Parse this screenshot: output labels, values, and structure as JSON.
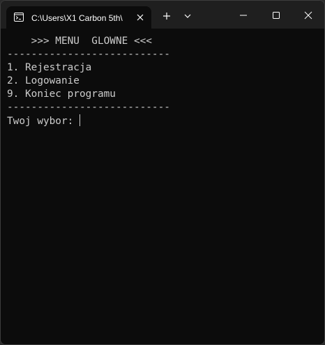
{
  "window": {
    "tab_title": "C:\\Users\\X1 Carbon 5th\\",
    "tab_icon": "terminal-icon",
    "close_tab_icon": "close-icon",
    "new_tab_icon": "plus-icon",
    "dropdown_icon": "chevron-down-icon",
    "minimize_icon": "minimize-icon",
    "maximize_icon": "maximize-icon",
    "close_window_icon": "close-icon"
  },
  "console": {
    "lines": [
      "    >>> MENU  GLOWNE <<<",
      "---------------------------",
      "1. Rejestracja",
      "2. Logowanie",
      "9. Koniec programu",
      "---------------------------"
    ],
    "prompt": "Twoj wybor: "
  },
  "colors": {
    "background": "#0c0c0c",
    "foreground": "#cccccc",
    "titlebar": "#1f1f1f"
  }
}
